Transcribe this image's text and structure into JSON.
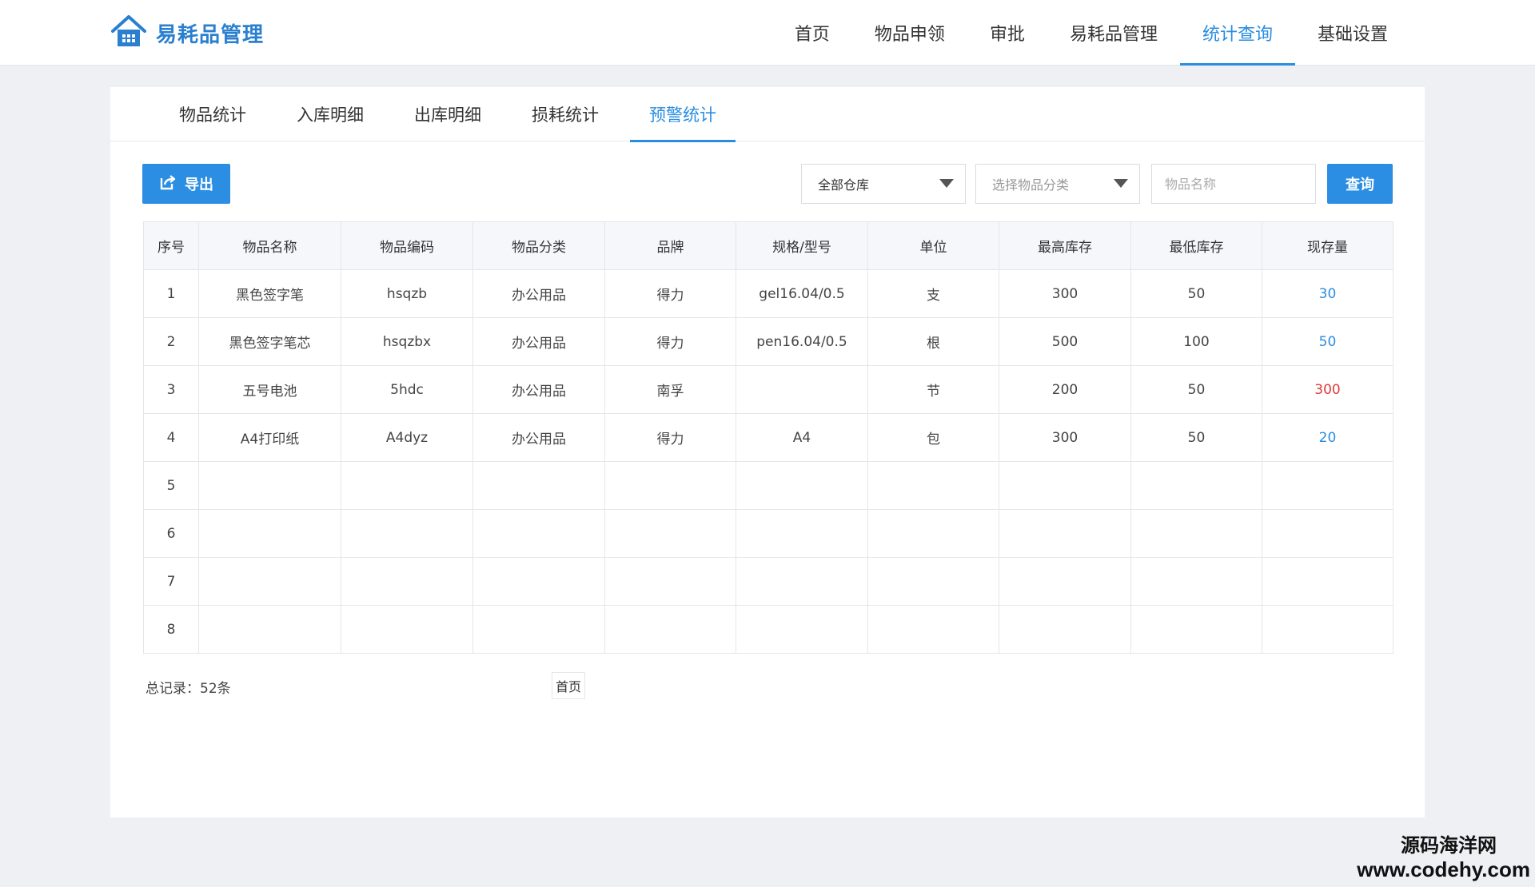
{
  "app": {
    "title": "易耗品管理",
    "logo_icon": "house-icon",
    "accent": "#2a8de0"
  },
  "nav": {
    "items": [
      {
        "label": "首页"
      },
      {
        "label": "物品申领"
      },
      {
        "label": "审批"
      },
      {
        "label": "易耗品管理"
      },
      {
        "label": "统计查询",
        "active": true
      },
      {
        "label": "基础设置"
      }
    ]
  },
  "subtabs": [
    {
      "label": "物品统计"
    },
    {
      "label": "入库明细"
    },
    {
      "label": "出库明细"
    },
    {
      "label": "损耗统计"
    },
    {
      "label": "预警统计",
      "active": true
    }
  ],
  "toolbar": {
    "export_label": "导出",
    "export_icon": "export-icon",
    "warehouse_value": "全部仓库",
    "category_placeholder": "选择物品分类",
    "name_placeholder": "物品名称",
    "query_label": "查询"
  },
  "table": {
    "columns": [
      "序号",
      "物品名称",
      "物品编码",
      "物品分类",
      "品牌",
      "规格/型号",
      "单位",
      "最高库存",
      "最低库存",
      "现存量"
    ],
    "rows": [
      {
        "no": "1",
        "name": "黑色签字笔",
        "code": "hsqzb",
        "category": "办公用品",
        "brand": "得力",
        "spec": "gel16.04/0.5",
        "unit": "支",
        "max": "300",
        "min": "50",
        "stock": "30",
        "stock_status": "low"
      },
      {
        "no": "2",
        "name": "黑色签字笔芯",
        "code": "hsqzbx",
        "category": "办公用品",
        "brand": "得力",
        "spec": "pen16.04/0.5",
        "unit": "根",
        "max": "500",
        "min": "100",
        "stock": "50",
        "stock_status": "low"
      },
      {
        "no": "3",
        "name": "五号电池",
        "code": "5hdc",
        "category": "办公用品",
        "brand": "南孚",
        "spec": "",
        "unit": "节",
        "max": "200",
        "min": "50",
        "stock": "300",
        "stock_status": "high"
      },
      {
        "no": "4",
        "name": "A4打印纸",
        "code": "A4dyz",
        "category": "办公用品",
        "brand": "得力",
        "spec": "A4",
        "unit": "包",
        "max": "300",
        "min": "50",
        "stock": "20",
        "stock_status": "low"
      },
      {
        "no": "5",
        "name": "",
        "code": "",
        "category": "",
        "brand": "",
        "spec": "",
        "unit": "",
        "max": "",
        "min": "",
        "stock": "",
        "stock_status": ""
      },
      {
        "no": "6",
        "name": "",
        "code": "",
        "category": "",
        "brand": "",
        "spec": "",
        "unit": "",
        "max": "",
        "min": "",
        "stock": "",
        "stock_status": ""
      },
      {
        "no": "7",
        "name": "",
        "code": "",
        "category": "",
        "brand": "",
        "spec": "",
        "unit": "",
        "max": "",
        "min": "",
        "stock": "",
        "stock_status": ""
      },
      {
        "no": "8",
        "name": "",
        "code": "",
        "category": "",
        "brand": "",
        "spec": "",
        "unit": "",
        "max": "",
        "min": "",
        "stock": "",
        "stock_status": ""
      }
    ]
  },
  "pagination": {
    "total_label": "总记录：52条",
    "first_label": "首页"
  },
  "watermark": {
    "line1": "源码海洋网",
    "line2": "www.codehy.com"
  }
}
